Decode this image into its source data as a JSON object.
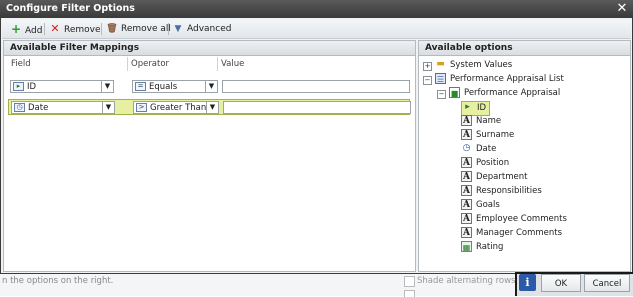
{
  "dialog": {
    "title": "Configure Filter Options"
  },
  "toolbar": {
    "add_label": "Add",
    "remove_label": "Remove",
    "remove_all_label": "Remove all",
    "advanced_label": "Advanced"
  },
  "mappings": {
    "title": "Available Filter Mappings",
    "columns": {
      "field": "Field",
      "operator": "Operator",
      "value": "Value"
    },
    "rows": [
      {
        "field": "ID",
        "field_icon": "id-field-icon",
        "operator": "Equals",
        "operator_icon": "equals-icon",
        "operator_glyph": "=",
        "value": ""
      },
      {
        "field": "Date",
        "field_icon": "date-field-icon",
        "operator": "Greater Than",
        "operator_icon": "greater-than-icon",
        "operator_glyph": ">",
        "value": ""
      }
    ]
  },
  "options": {
    "title": "Available options",
    "system_values": "System Values",
    "list": "Performance Appraisal List",
    "content_type": "Performance Appraisal",
    "fields": [
      "ID",
      "Name",
      "Surname",
      "Date",
      "Position",
      "Department",
      "Responsibilities",
      "Goals",
      "Employee Comments",
      "Manager Comments",
      "Rating"
    ],
    "selected_field": "ID"
  },
  "background": {
    "hint_text": "n the options on the right.",
    "shade_rows_label": "Shade alternating rows"
  },
  "footer": {
    "ok_label": "OK",
    "cancel_label": "Cancel"
  },
  "colors": {
    "accent": "#2a5aa8",
    "highlight": "#e6f0a0"
  }
}
